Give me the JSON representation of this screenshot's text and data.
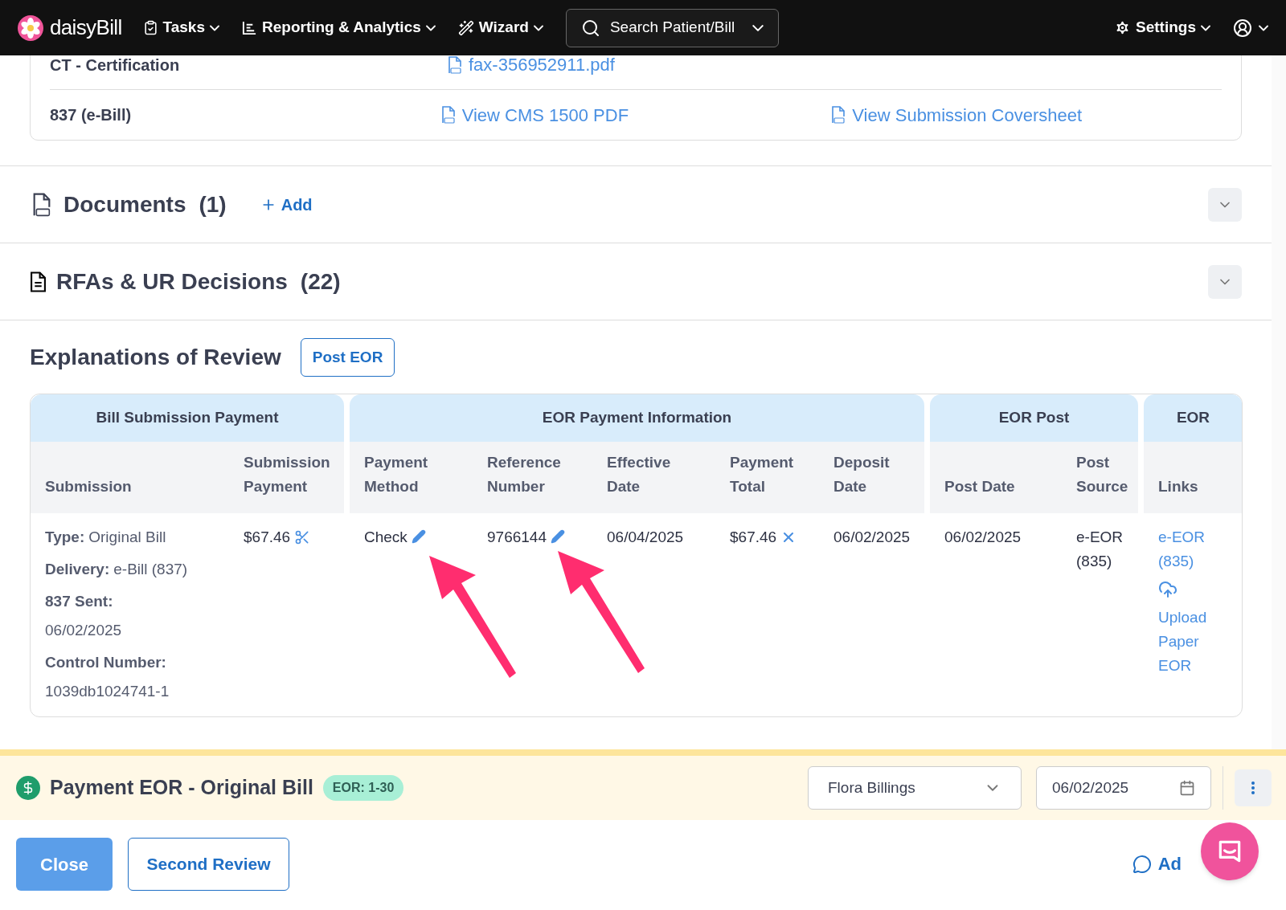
{
  "nav": {
    "brand": "daisyBill",
    "menus": [
      {
        "label": "Tasks"
      },
      {
        "label": "Reporting & Analytics"
      },
      {
        "label": "Wizard"
      }
    ],
    "search": "Search Patient/Bill",
    "settings": "Settings"
  },
  "files": [
    {
      "label": "CT - Certification",
      "links": [
        "fax-356952911.pdf"
      ]
    },
    {
      "label": "837 (e-Bill)",
      "links": [
        "View CMS 1500 PDF",
        "View Submission Coversheet"
      ]
    }
  ],
  "sections": [
    {
      "title": "Documents",
      "count": "(1)",
      "action": "Add",
      "expanded": false
    },
    {
      "title": "RFAs & UR Decisions",
      "count": "(22)",
      "expanded": false
    }
  ],
  "eor": {
    "title": "Explanations of Review",
    "button": "Post EOR",
    "groups": [
      {
        "title": "Bill Submission Payment",
        "columns": [
          "Submission",
          "Submission Payment"
        ]
      },
      {
        "title": "EOR Payment Information",
        "columns": [
          "Payment Method",
          "Reference Number",
          "Effective Date",
          "Payment Total",
          "Deposit Date"
        ]
      },
      {
        "title": "EOR Post",
        "columns": [
          "Post Date",
          "Post Source"
        ]
      },
      {
        "title": "EOR",
        "columns": [
          "Links"
        ]
      }
    ],
    "cells": [
      {
        "kind": "details",
        "lines": [
          {
            "label": "Type:",
            "value": "Original Bill",
            "kind": "inline"
          },
          {
            "label": "Delivery:",
            "value": "e-Bill (837)",
            "kind": "inline"
          },
          {
            "label": "837 Sent:",
            "value": "06/02/2025",
            "kind": "stacked"
          },
          {
            "label": "Control Number:",
            "value": "1039db1024741-1",
            "kind": "stacked"
          }
        ]
      },
      {
        "kind": "text",
        "text": "$67.46"
      },
      {
        "kind": "text",
        "text": "Check"
      },
      {
        "kind": "text",
        "text": "9766144"
      },
      {
        "kind": "text",
        "text": "06/04/2025"
      },
      {
        "kind": "text",
        "text": "$67.46"
      },
      {
        "kind": "text",
        "text": "06/02/2025"
      },
      {
        "kind": "text",
        "text": "06/02/2025"
      },
      {
        "kind": "text",
        "text": "e-EOR (835)"
      },
      {
        "kind": "links",
        "link": "e-EOR (835)",
        "upload": "Upload Paper EOR"
      }
    ]
  },
  "payment": {
    "title": "Payment EOR - Original Bill",
    "badge": "EOR: 1-30",
    "assignee": "Flora Billings",
    "date": "06/02/2025"
  },
  "actions": {
    "close": "Close",
    "second": "Second Review",
    "note": "Ad"
  }
}
